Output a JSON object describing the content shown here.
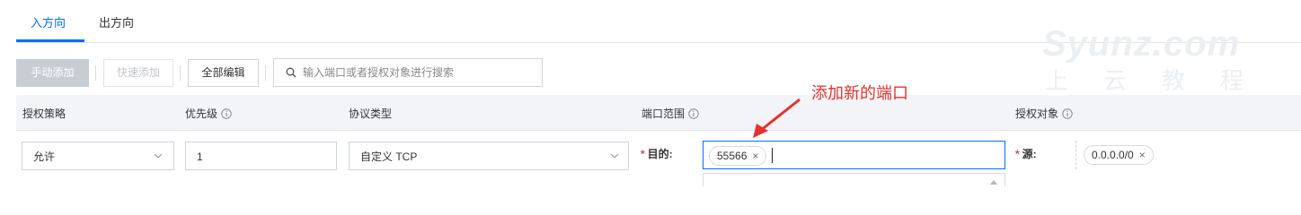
{
  "tabs": [
    {
      "label": "入方向",
      "active": true
    },
    {
      "label": "出方向",
      "active": false
    }
  ],
  "toolbar": {
    "manual_add": "手动添加",
    "quick_add": "快速添加",
    "edit_all": "全部编辑",
    "search_placeholder": "输入端口或者授权对象进行搜索"
  },
  "table": {
    "headers": [
      {
        "label": "授权策略",
        "info": false
      },
      {
        "label": "优先级",
        "info": true
      },
      {
        "label": "协议类型",
        "info": false
      },
      {
        "label": "端口范围",
        "info": true
      },
      {
        "label": "授权对象",
        "info": true
      }
    ],
    "row": {
      "policy": "允许",
      "priority": "1",
      "protocol": "自定义 TCP",
      "dest_label": "目的:",
      "port_tag": "55566",
      "source_label": "源:",
      "source_tag": "0.0.0.0/0"
    }
  },
  "annotation": {
    "text": "添加新的端口",
    "color": "#e5322d"
  },
  "watermark": {
    "title": "Syunz.com",
    "subtitle": "上云教程"
  },
  "colors": {
    "accent": "#006eff",
    "header_bg": "#f2f4f7",
    "required": "#e54545"
  },
  "icons": {
    "search": "search-icon",
    "info": "info-icon",
    "chevron": "chevron-down-icon",
    "close": "close-icon",
    "arrow": "annotation-arrow-icon"
  }
}
